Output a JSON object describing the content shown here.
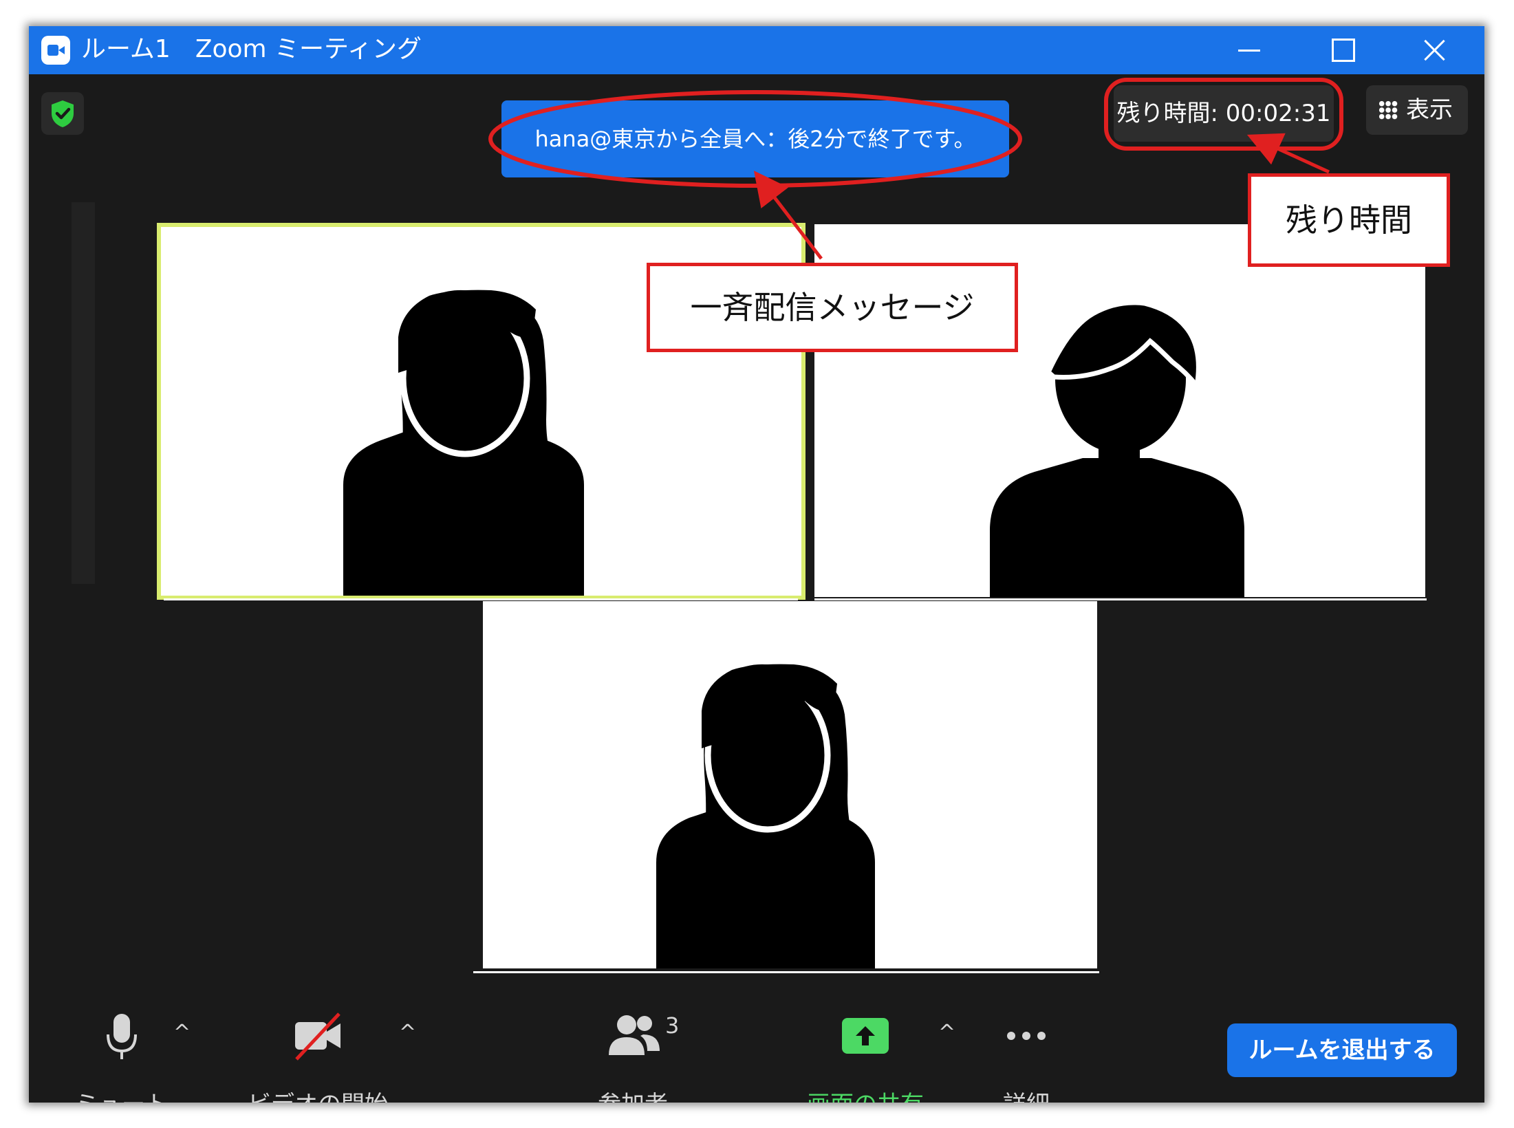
{
  "window": {
    "title": "ルーム1　Zoom ミーティング"
  },
  "broadcast": {
    "message": "hana@東京から全員へ：後2分で終了です。"
  },
  "timer": {
    "text": "残り時間: 00:02:31"
  },
  "view_button": {
    "label": "表示"
  },
  "annotations": {
    "broadcast_callout": "一斉配信メッセージ",
    "timer_callout": "残り時間"
  },
  "toolbar": {
    "mute": "ミュート",
    "video": "ビデオの開始",
    "participants": "参加者",
    "participants_count": "3",
    "share": "画面の共有",
    "more": "詳細",
    "leave": "ルームを退出する"
  },
  "colors": {
    "titlebar": "#1a73e8",
    "background": "#1a1a1a",
    "share_green": "#4cd964",
    "annotation_red": "#e02020",
    "active_speaker_border": "#d9ec6f"
  }
}
